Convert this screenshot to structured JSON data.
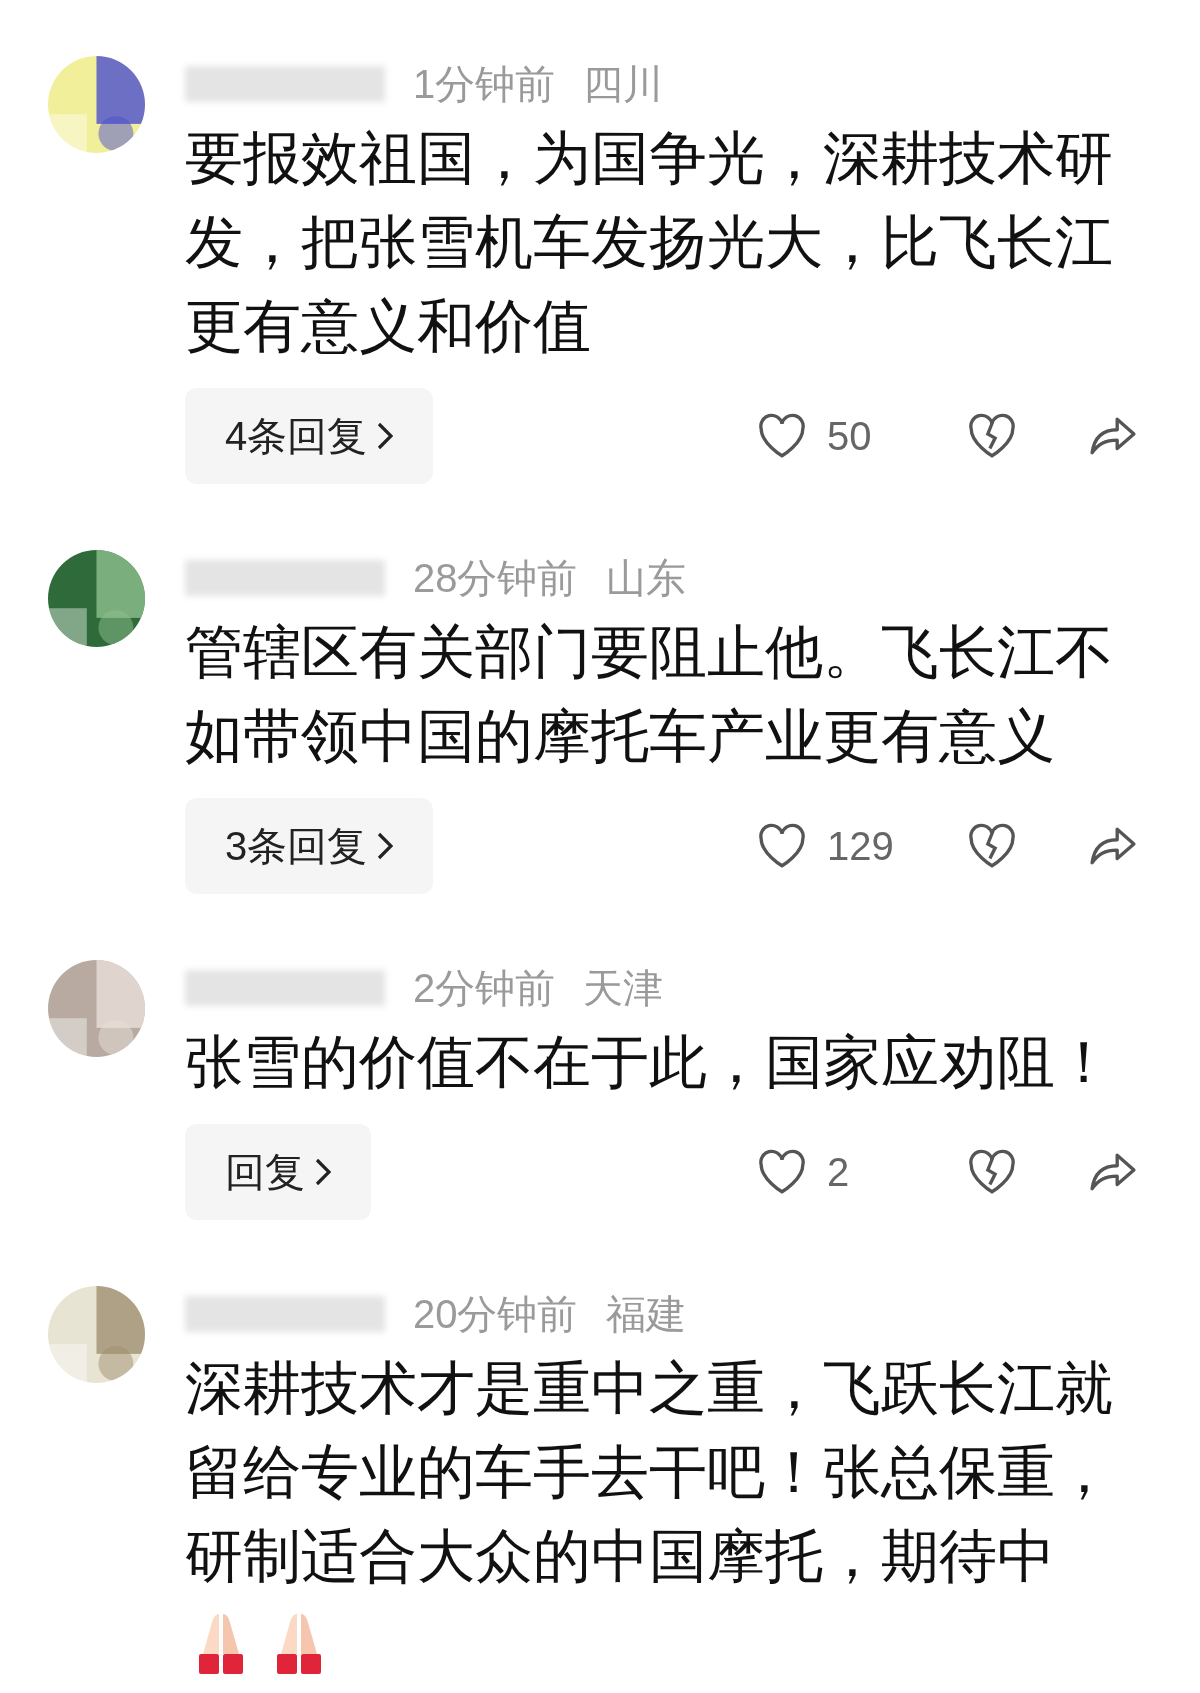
{
  "comments": [
    {
      "time": "1分钟前",
      "location": "四川",
      "text": "要报效祖国，为国争光，深耕技术研发，把张雪机车发扬光大，比飞长江更有意义和价值",
      "replies": "4条回复",
      "likes": "50"
    },
    {
      "time": "28分钟前",
      "location": "山东",
      "text": "管辖区有关部门要阻止他。飞长江不如带领中国的摩托车产业更有意义",
      "replies": "3条回复",
      "likes": "129"
    },
    {
      "time": "2分钟前",
      "location": "天津",
      "text": "张雪的价值不在于此，国家应劝阻！",
      "replies": "回复",
      "likes": "2"
    },
    {
      "time": "20分钟前",
      "location": "福建",
      "text": "深耕技术才是重中之重，飞跃长江就留给专业的车手去干吧！张总保重，研制适合大众的中国摩托，期待中",
      "trailing": [
        {
          "kind": "praying-hands"
        },
        {
          "kind": "praying-hands"
        }
      ]
    }
  ]
}
